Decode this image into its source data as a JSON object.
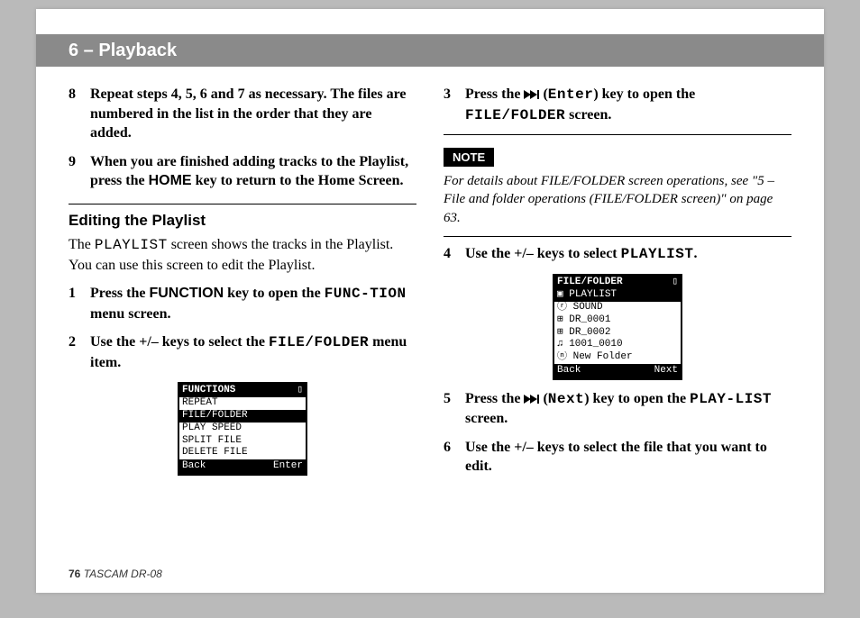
{
  "banner": "6 – Playback",
  "left": {
    "step8": {
      "num": "8",
      "text": "Repeat steps 4, 5, 6 and 7 as necessary. The files are numbered in the list in the order that they are added."
    },
    "step9": {
      "num": "9",
      "a": "When you are finished adding tracks to the Playlist, press the ",
      "home": "HOME",
      "b": " key to return to the Home Screen."
    },
    "subhead": "Editing the Playlist",
    "intro": {
      "a": "The ",
      "mono": "PLAYLIST",
      "b": " screen shows the tracks in the Playlist. You can use this screen to edit the Playlist."
    },
    "step1": {
      "num": "1",
      "a": "Press the ",
      "fn": "FUNCTION",
      "b": " key to open the ",
      "mono": "FUNC-TION",
      "c": " menu screen."
    },
    "step2": {
      "num": "2",
      "a": "Use the +/– keys to select the ",
      "mono": "FILE/FOLDER",
      "b": " menu item."
    },
    "lcd": {
      "title": "FUNCTIONS",
      "batt": "▯",
      "rows": [
        "REPEAT",
        "FILE/FOLDER",
        "PLAY SPEED",
        "SPLIT FILE",
        "DELETE FILE"
      ],
      "selectedIndex": 1,
      "back": "Back",
      "enter": "Enter"
    }
  },
  "right": {
    "step3": {
      "num": "3",
      "a": "Press the ",
      "enter": "Enter",
      "b": ") key to open the ",
      "mono": "FILE/FOLDER",
      "c": " screen."
    },
    "noteLabel": "NOTE",
    "noteText": "For details about FILE/FOLDER screen operations, see \"5 – File and folder operations (FILE/FOLDER screen)\" on page 63.",
    "step4": {
      "num": "4",
      "a": "Use the +/– keys to select ",
      "mono": "PLAYLIST",
      "b": "."
    },
    "lcd": {
      "title": "FILE/FOLDER",
      "batt": "▯",
      "rows": [
        {
          "icon": "▣",
          "label": "PLAYLIST",
          "sel": true
        },
        {
          "icon": "ⓡ",
          "label": "SOUND"
        },
        {
          "icon": "⊞",
          "label": "DR_0001"
        },
        {
          "icon": "⊞",
          "label": "DR_0002"
        },
        {
          "icon": "♫",
          "label": "1001_0010"
        },
        {
          "icon": "ⓝ",
          "label": "New Folder"
        }
      ],
      "back": "Back",
      "next": "Next"
    },
    "step5": {
      "num": "5",
      "a": "Press the ",
      "next": "Next",
      "b": ") key to open the ",
      "mono": "PLAY-LIST",
      "c": " screen."
    },
    "step6": {
      "num": "6",
      "text": "Use the +/– keys to select the file that you want to edit."
    }
  },
  "footer": {
    "page": "76",
    "product": "TASCAM  DR-08"
  }
}
